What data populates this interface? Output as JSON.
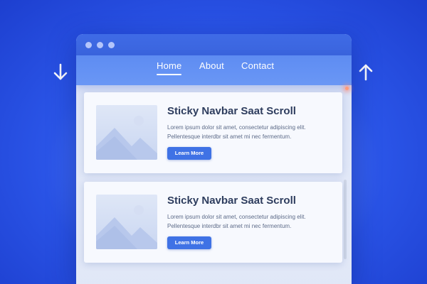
{
  "window": {
    "controls": [
      "window-dot",
      "window-dot",
      "window-dot"
    ]
  },
  "navbar": {
    "links": [
      {
        "label": "Home",
        "active": true
      },
      {
        "label": "About",
        "active": false
      },
      {
        "label": "Contact",
        "active": false
      }
    ]
  },
  "cards": [
    {
      "title": "Sticky Navbar Saat Scroll",
      "text": "Lorem ipsum dolor sit amet, consectetur adipiscing elit. Pellentesque interdbr sit amet mi nec fermentum.",
      "button": "Learn More",
      "image_icon": "image-placeholder-icon"
    },
    {
      "title": "Sticky Navbar Saat Scroll",
      "text": "Lorem ipsum dolor sit amet, consectetur adipiscing elit. Pellentesque interdbr sit amet mi nec fermentum.",
      "button": "Learn More",
      "image_icon": "image-placeholder-icon"
    }
  ],
  "icons": {
    "left": "arrow-down-icon",
    "right": "arrow-up-icon"
  },
  "colors": {
    "background": "#2f5cf0",
    "navbar": "#6a97f5",
    "button": "#3f72e5",
    "title": "#2e3d5e"
  }
}
